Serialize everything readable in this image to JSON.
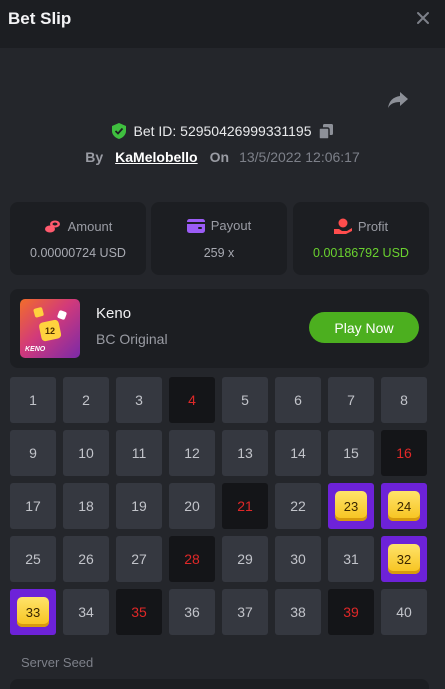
{
  "header": {
    "title": "Bet Slip"
  },
  "bet": {
    "id_label": "Bet ID: 52950426999331195",
    "by_label": "By",
    "username": "KaMelobello",
    "on_label": "On",
    "date": "13/5/2022 12:06:17"
  },
  "stats": {
    "amount": {
      "label": "Amount",
      "value": "0.00000724 USD",
      "icon": "coins-icon",
      "color": "#ff5a6e"
    },
    "payout": {
      "label": "Payout",
      "value": "259 x",
      "icon": "wallet-icon",
      "color": "#9b5cf6"
    },
    "profit": {
      "label": "Profit",
      "value": "0.00186792 USD",
      "icon": "hand-coin-icon",
      "color": "#ff4d4d",
      "value_color": "#6ad22f"
    }
  },
  "game": {
    "name": "Keno",
    "subtitle": "BC Original",
    "thumb_tag": "KENO",
    "thumb_ball": "12",
    "play_label": "Play Now"
  },
  "board": {
    "numbers": [
      "1",
      "2",
      "3",
      "4",
      "5",
      "6",
      "7",
      "8",
      "9",
      "10",
      "11",
      "12",
      "13",
      "14",
      "15",
      "16",
      "17",
      "18",
      "19",
      "20",
      "21",
      "22",
      "23",
      "24",
      "25",
      "26",
      "27",
      "28",
      "29",
      "30",
      "31",
      "32",
      "33",
      "34",
      "35",
      "36",
      "37",
      "38",
      "39",
      "40"
    ],
    "selected_misses": [
      "4",
      "16",
      "21",
      "28",
      "35",
      "39"
    ],
    "hits": [
      "23",
      "24",
      "32",
      "33"
    ]
  },
  "footer": {
    "server_seed_label": "Server Seed"
  },
  "colors": {
    "accent_green": "#4caf1f",
    "hit_purple": "#6d22d8",
    "miss_red": "#e02828"
  }
}
